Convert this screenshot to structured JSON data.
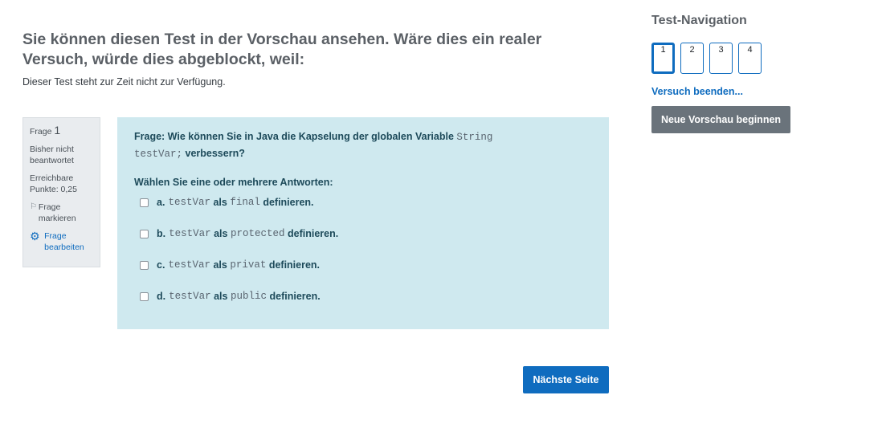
{
  "page": {
    "heading": "Sie können diesen Test in der Vorschau ansehen. Wäre dies ein realer Versuch, würde dies abgeblockt, weil:",
    "reason": "Dieser Test steht zur Zeit nicht zur Verfügung."
  },
  "question_info": {
    "label": "Frage",
    "number": "1",
    "status": "Bisher nicht beantwortet",
    "points": "Erreichbare Punkte: 0,25",
    "flag_label": "Frage markieren",
    "edit_label": "Frage bearbeiten"
  },
  "question": {
    "text_before": "Frage: Wie können Sie in Java die Kapselung der globalen Variable",
    "code": "String testVar;",
    "text_after": "verbessern?",
    "prompt": "Wählen Sie eine oder mehrere Antworten:",
    "options": [
      {
        "letter": "a.",
        "var": "testVar",
        "als": "als",
        "modifier": "final",
        "verb": "definieren."
      },
      {
        "letter": "b.",
        "var": "testVar",
        "als": "als",
        "modifier": "protected",
        "verb": "definieren."
      },
      {
        "letter": "c.",
        "var": "testVar",
        "als": "als",
        "modifier": "privat",
        "verb": "definieren."
      },
      {
        "letter": "d.",
        "var": "testVar",
        "als": "als",
        "modifier": "public",
        "verb": "definieren."
      }
    ]
  },
  "next_button": "Nächste Seite",
  "navigation": {
    "title": "Test-Navigation",
    "buttons": [
      "1",
      "2",
      "3",
      "4"
    ],
    "current": "1",
    "finish_link": "Versuch beenden...",
    "restart_button": "Neue Vorschau beginnen"
  },
  "colors": {
    "accent": "#0f6cbf",
    "question_bg": "#cfe9ef",
    "info_bg": "#e9ecef",
    "secondary_button": "#6a737b"
  }
}
